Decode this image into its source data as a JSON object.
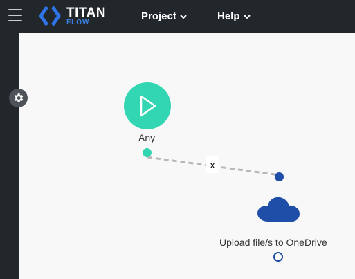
{
  "header": {
    "menu_icon": "hamburger-icon",
    "logo": {
      "title": "TITAN",
      "subtitle": "FLOW"
    },
    "nav": [
      {
        "label": "Project",
        "icon": "chevron-down-icon"
      },
      {
        "label": "Help",
        "icon": "chevron-down-icon"
      }
    ]
  },
  "sidebar": {
    "settings_icon": "gear-icon"
  },
  "canvas": {
    "start_node": {
      "label": "Any",
      "icon": "play-icon",
      "color": "#33d6b2"
    },
    "connector": {
      "remove_label": "x"
    },
    "action_node": {
      "label": "Upload file/s to OneDrive",
      "icon": "onedrive-cloud-icon",
      "color": "#1f4ea8"
    }
  },
  "colors": {
    "topbar": "#22272b",
    "accent": "#33d6b2",
    "brand": "#1f4ea8",
    "canvas": "#f8f8f8"
  }
}
